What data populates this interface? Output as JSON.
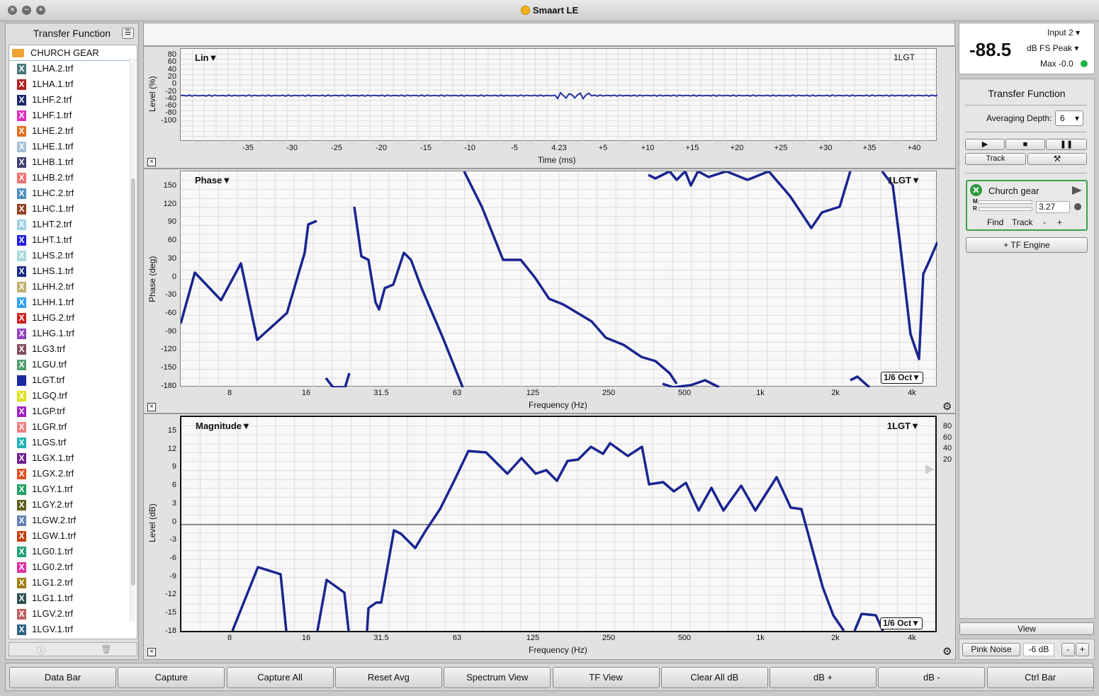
{
  "window": {
    "title": "Smaart LE"
  },
  "left": {
    "header": "Transfer Function",
    "folder": "CHURCH GEAR",
    "files": [
      {
        "name": "1LHA.2.trf",
        "color": "#4a7a7a"
      },
      {
        "name": "1LHA.1.trf",
        "color": "#b02020"
      },
      {
        "name": "1LHF.2.trf",
        "color": "#1a2a6a"
      },
      {
        "name": "1LHF.1.trf",
        "color": "#e030c0"
      },
      {
        "name": "1LHE.2.trf",
        "color": "#e07020"
      },
      {
        "name": "1LHE.1.trf",
        "color": "#a8c0d8"
      },
      {
        "name": "1LHB.1.trf",
        "color": "#404070"
      },
      {
        "name": "1LHB.2.trf",
        "color": "#f07070"
      },
      {
        "name": "1LHC.2.trf",
        "color": "#4a90c0"
      },
      {
        "name": "1LHC.1.trf",
        "color": "#904020"
      },
      {
        "name": "1LHT.2.trf",
        "color": "#a0d0e8"
      },
      {
        "name": "1LHT.1.trf",
        "color": "#2020e0"
      },
      {
        "name": "1LHS.2.trf",
        "color": "#a8d8e0"
      },
      {
        "name": "1LHS.1.trf",
        "color": "#1a2a80"
      },
      {
        "name": "1LHH.2.trf",
        "color": "#c0b070"
      },
      {
        "name": "1LHH.1.trf",
        "color": "#30a0f0"
      },
      {
        "name": "1LHG.2.trf",
        "color": "#d02020"
      },
      {
        "name": "1LHG.1.trf",
        "color": "#9040c0"
      },
      {
        "name": "1LG3.trf",
        "color": "#805060"
      },
      {
        "name": "1LGU.trf",
        "color": "#50a070"
      },
      {
        "name": "1LGT.trf",
        "color": "#1a2aa0"
      },
      {
        "name": "1LGQ.trf",
        "color": "#e0e020"
      },
      {
        "name": "1LGP.trf",
        "color": "#a020c0"
      },
      {
        "name": "1LGR.trf",
        "color": "#f08080"
      },
      {
        "name": "1LGS.trf",
        "color": "#20b0b0"
      },
      {
        "name": "1LGX.1.trf",
        "color": "#702090"
      },
      {
        "name": "1LGX.2.trf",
        "color": "#e05020"
      },
      {
        "name": "1LGY.1.trf",
        "color": "#20a060"
      },
      {
        "name": "1LGY.2.trf",
        "color": "#606020"
      },
      {
        "name": "1LGW.2.trf",
        "color": "#6080b0"
      },
      {
        "name": "1LGW.1.trf",
        "color": "#c04010"
      },
      {
        "name": "1LG0.1.trf",
        "color": "#20a070"
      },
      {
        "name": "1LG0.2.trf",
        "color": "#e030a0"
      },
      {
        "name": "1LG1.2.trf",
        "color": "#a08010"
      },
      {
        "name": "1LG1.1.trf",
        "color": "#305050"
      },
      {
        "name": "1LGV.2.trf",
        "color": "#c06060"
      },
      {
        "name": "1LGV.1.trf",
        "color": "#306080"
      }
    ]
  },
  "plots": {
    "impulse": {
      "title": "Lin",
      "trace": "1LGT",
      "ylabel": "Level (%)",
      "xlabel": "Time (ms)",
      "yticks": [
        "80",
        "60",
        "40",
        "20",
        "0",
        "-20",
        "-40",
        "-60",
        "-80",
        "-100"
      ],
      "xticks": [
        "-35",
        "-30",
        "-25",
        "-20",
        "-15",
        "-10",
        "-5",
        "4.23",
        "+5",
        "+10",
        "+15",
        "+20",
        "+25",
        "+30",
        "+35",
        "+40"
      ]
    },
    "phase": {
      "title": "Phase",
      "trace": "1LGT",
      "ylabel": "Phase (deg)",
      "xlabel": "Frequency (Hz)",
      "smoothing": "1/6 Oct",
      "yticks": [
        "150",
        "120",
        "90",
        "60",
        "30",
        "0",
        "-30",
        "-60",
        "-90",
        "-120",
        "-150",
        "-180"
      ],
      "xticks": [
        "8",
        "16",
        "31.5",
        "63",
        "125",
        "250",
        "500",
        "1k",
        "2k",
        "4k"
      ]
    },
    "magnitude": {
      "title": "Magnitude",
      "trace": "1LGT",
      "ylabel": "Level (dB)",
      "xlabel": "Frequency (Hz)",
      "smoothing": "1/6 Oct",
      "yticks": [
        "15",
        "12",
        "9",
        "6",
        "3",
        "0",
        "-3",
        "-6",
        "-9",
        "-12",
        "-15",
        "-18"
      ],
      "xticks": [
        "8",
        "16",
        "31.5",
        "63",
        "125",
        "250",
        "500",
        "1k",
        "2k",
        "4k"
      ],
      "coh_ticks": [
        "80",
        "60",
        "40",
        "20"
      ]
    }
  },
  "meter": {
    "value": "-88.5",
    "input": "Input 2",
    "mode": "dB FS Peak",
    "max": "Max -0.0"
  },
  "tf": {
    "title": "Transfer Function",
    "avg_label": "Averaging Depth:",
    "avg_value": "6",
    "track": "Track"
  },
  "engine": {
    "name": "Church gear",
    "delay": "3.27",
    "find": "Find",
    "track": "Track",
    "minus": "-",
    "plus": "+",
    "m": "M",
    "r": "R"
  },
  "add_engine": "+ TF Engine",
  "view": "View",
  "generator": {
    "label": "Pink Noise",
    "level": "-6 dB",
    "minus": "-",
    "plus": "+"
  },
  "bottom": [
    "Data Bar",
    "Capture",
    "Capture All",
    "Reset Avg",
    "Spectrum View",
    "TF View",
    "Clear All dB",
    "dB +",
    "dB -",
    "Ctrl Bar"
  ]
}
